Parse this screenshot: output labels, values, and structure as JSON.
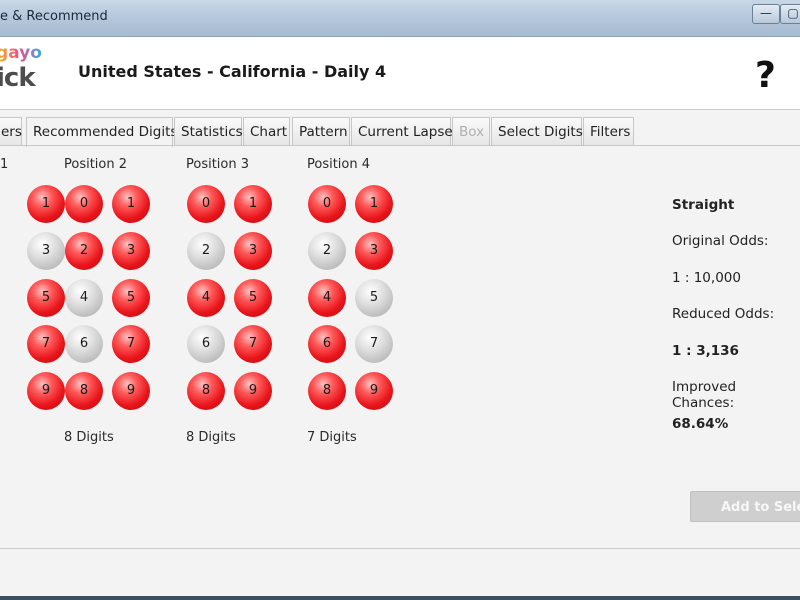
{
  "window": {
    "title": "e & Recommend",
    "minimize_glyph": "—",
    "maximize_glyph": "▢"
  },
  "header": {
    "logo_top": "gayo",
    "logo_bottom": "ick",
    "title": "United States - California - Daily 4",
    "help_glyph": "?"
  },
  "tabs": [
    {
      "label": "ers",
      "state": "normal"
    },
    {
      "label": "Recommended Digits",
      "state": "active"
    },
    {
      "label": "Statistics",
      "state": "normal"
    },
    {
      "label": "Chart",
      "state": "normal"
    },
    {
      "label": "Pattern",
      "state": "normal"
    },
    {
      "label": "Current Lapse",
      "state": "normal"
    },
    {
      "label": "Box",
      "state": "disabled"
    },
    {
      "label": "Select Digits",
      "state": "normal"
    },
    {
      "label": "Filters",
      "state": "normal"
    }
  ],
  "positions": [
    {
      "label": "1",
      "digits_count": "",
      "balls": [
        {
          "digit": "1",
          "selected": true
        },
        {
          "digit": "3",
          "selected": false
        },
        {
          "digit": "5",
          "selected": true
        },
        {
          "digit": "7",
          "selected": true
        },
        {
          "digit": "9",
          "selected": true
        }
      ]
    },
    {
      "label": "Position 2",
      "digits_count": "8 Digits",
      "balls": [
        {
          "digit": "0",
          "selected": true
        },
        {
          "digit": "1",
          "selected": true
        },
        {
          "digit": "2",
          "selected": true
        },
        {
          "digit": "3",
          "selected": true
        },
        {
          "digit": "4",
          "selected": false
        },
        {
          "digit": "5",
          "selected": true
        },
        {
          "digit": "6",
          "selected": false
        },
        {
          "digit": "7",
          "selected": true
        },
        {
          "digit": "8",
          "selected": true
        },
        {
          "digit": "9",
          "selected": true
        }
      ]
    },
    {
      "label": "Position 3",
      "digits_count": "8 Digits",
      "balls": [
        {
          "digit": "0",
          "selected": true
        },
        {
          "digit": "1",
          "selected": true
        },
        {
          "digit": "2",
          "selected": false
        },
        {
          "digit": "3",
          "selected": true
        },
        {
          "digit": "4",
          "selected": true
        },
        {
          "digit": "5",
          "selected": true
        },
        {
          "digit": "6",
          "selected": false
        },
        {
          "digit": "7",
          "selected": true
        },
        {
          "digit": "8",
          "selected": true
        },
        {
          "digit": "9",
          "selected": true
        }
      ]
    },
    {
      "label": "Position 4",
      "digits_count": "7 Digits",
      "balls": [
        {
          "digit": "0",
          "selected": true
        },
        {
          "digit": "1",
          "selected": true
        },
        {
          "digit": "2",
          "selected": false
        },
        {
          "digit": "3",
          "selected": true
        },
        {
          "digit": "4",
          "selected": true
        },
        {
          "digit": "5",
          "selected": false
        },
        {
          "digit": "6",
          "selected": true
        },
        {
          "digit": "7",
          "selected": false
        },
        {
          "digit": "8",
          "selected": true
        },
        {
          "digit": "9",
          "selected": true
        }
      ]
    }
  ],
  "odds": {
    "play_type": "Straight",
    "original_label": "Original Odds:",
    "original_value": "1 : 10,000",
    "reduced_label": "Reduced Odds:",
    "reduced_value": "1 : 3,136",
    "improved_label": "Improved Chances:",
    "improved_value": "68.64%"
  },
  "actions": {
    "add_label": "Add to Selec"
  },
  "colors": {
    "selected_ball": "#e8151b",
    "unselected_ball": "#bdbdbd",
    "titlebar": "#b3c6da"
  }
}
